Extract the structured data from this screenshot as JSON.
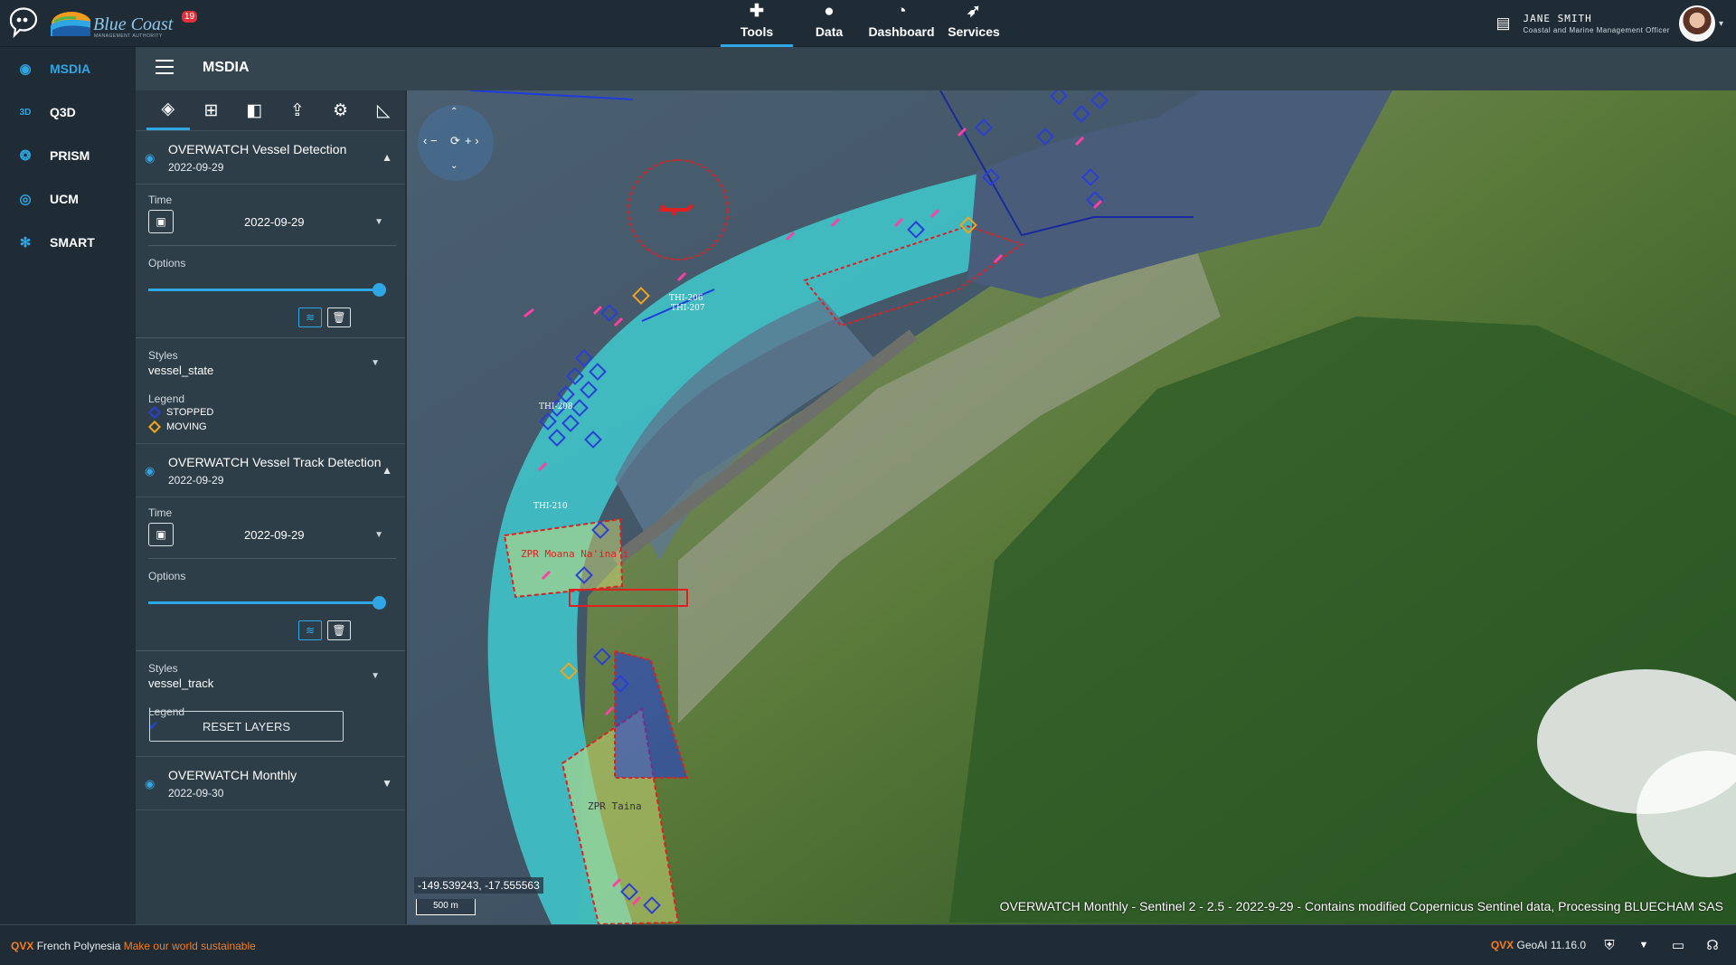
{
  "header": {
    "brand": "Blue Coast",
    "brand_sub": "MANAGEMENT AUTHORITY",
    "notification_count": "19",
    "nav": [
      {
        "label": "Tools",
        "icon": "puzzle-icon",
        "active": true
      },
      {
        "label": "Data",
        "icon": "lightbulb-icon",
        "active": false
      },
      {
        "label": "Dashboard",
        "icon": "gauge-icon",
        "active": false
      },
      {
        "label": "Services",
        "icon": "rocket-icon",
        "active": false
      }
    ],
    "user": {
      "name": "JANE SMITH",
      "role": "Coastal and Marine Management Officer"
    }
  },
  "sidebar": {
    "items": [
      {
        "label": "MSDIA",
        "icon": "globe-icon",
        "active": true
      },
      {
        "label": "Q3D",
        "icon": "3d-icon",
        "active": false
      },
      {
        "label": "PRISM",
        "icon": "prism-icon",
        "active": false
      },
      {
        "label": "UCM",
        "icon": "ucm-icon",
        "active": false
      },
      {
        "label": "SMART",
        "icon": "smart-icon",
        "active": false
      }
    ]
  },
  "panel": {
    "title": "MSDIA",
    "tools": [
      "layers-icon",
      "add-layer-icon",
      "compare-icon",
      "share-icon",
      "settings-icon",
      "measure-icon"
    ],
    "layers": [
      {
        "name": "OVERWATCH Vessel Detection",
        "date": "2022-09-29",
        "time_label": "Time",
        "time_value": "2022-09-29",
        "options_label": "Options",
        "opacity": 1.0,
        "styles_label": "Styles",
        "style_value": "vessel_state",
        "legend_label": "Legend",
        "legend": [
          {
            "label": "STOPPED",
            "color": "#2a3fd6"
          },
          {
            "label": "MOVING",
            "color": "#f2a51a"
          }
        ]
      },
      {
        "name": "OVERWATCH Vessel Track Detection",
        "date": "2022-09-29",
        "time_label": "Time",
        "time_value": "2022-09-29",
        "options_label": "Options",
        "opacity": 1.0,
        "styles_label": "Styles",
        "style_value": "vessel_track",
        "legend_label": "Legend"
      },
      {
        "name": "OVERWATCH Monthly",
        "date": "2022-09-30"
      }
    ],
    "reset_label": "RESET LAYERS"
  },
  "map": {
    "coordinates": "-149.539243, -17.555563",
    "scale": "500 m",
    "attribution": "OVERWATCH Monthly - Sentinel 2 - 2.5 - 2022-9-29 - Contains modified Copernicus Sentinel data, Processing BLUECHAM SAS",
    "labels": {
      "zone1": "ZPR Moana Na'ina'i",
      "zone2": "ZPR Taina",
      "thi206": "THI-206",
      "thi207": "THI-207",
      "thi208": "THI-208",
      "thi210": "THI-210"
    }
  },
  "footer": {
    "left_prefix": "QVX",
    "left_region": "French Polynesia",
    "left_tagline": "Make our world sustainable",
    "version_prefix": "QVX",
    "version": "GeoAI 11.16.0"
  },
  "colors": {
    "accent": "#2fa7e4",
    "stopped": "#2a3fd6",
    "moving": "#f2a51a",
    "zone": "#e02020"
  }
}
